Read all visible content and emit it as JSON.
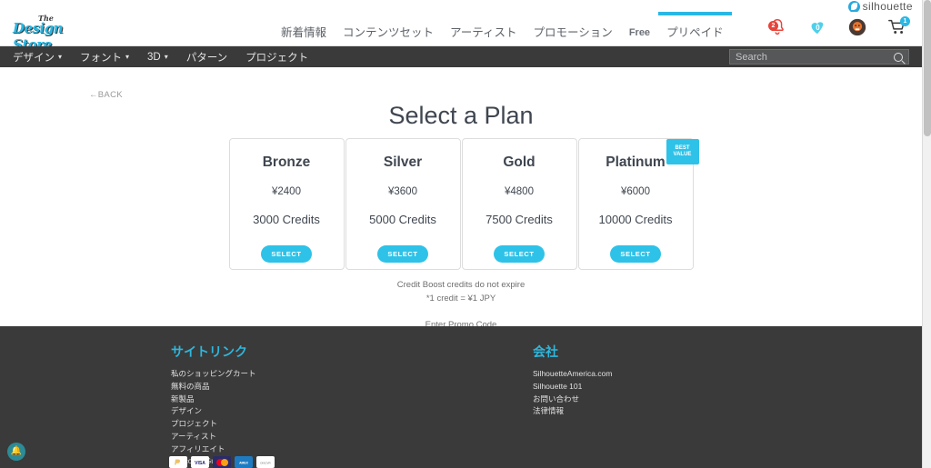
{
  "brand": {
    "silhouette_label": "silhouette",
    "logo_the": "The",
    "logo_main": "Design Store"
  },
  "topnav": {
    "links": [
      {
        "label": "新着情報",
        "active": false,
        "small": false
      },
      {
        "label": "コンテンツセット",
        "active": false,
        "small": false
      },
      {
        "label": "アーティスト",
        "active": false,
        "small": false
      },
      {
        "label": "プロモーション",
        "active": false,
        "small": false
      },
      {
        "label": "Free",
        "active": false,
        "small": true
      },
      {
        "label": "プリペイド",
        "active": true,
        "small": false
      }
    ],
    "icons": {
      "notifications_count": "2",
      "favorites_count": "0",
      "cart_count": "1"
    }
  },
  "darknav": {
    "items": [
      {
        "label": "デザイン",
        "caret": true
      },
      {
        "label": "フォント",
        "caret": true
      },
      {
        "label": "3D",
        "caret": true
      },
      {
        "label": "パターン",
        "caret": false
      },
      {
        "label": "プロジェクト",
        "caret": false
      }
    ],
    "search": {
      "placeholder": "Search",
      "value": ""
    }
  },
  "main": {
    "back_label": "←BACK",
    "title": "Select a Plan",
    "plans": [
      {
        "name": "Bronze",
        "price": "¥2400",
        "credits": "3000 Credits",
        "button": "SELECT",
        "badge": null
      },
      {
        "name": "Silver",
        "price": "¥3600",
        "credits": "5000 Credits",
        "button": "SELECT",
        "badge": null
      },
      {
        "name": "Gold",
        "price": "¥4800",
        "credits": "7500 Credits",
        "button": "SELECT",
        "badge": null
      },
      {
        "name": "Platinum",
        "price": "¥6000",
        "credits": "10000 Credits",
        "button": "SELECT",
        "badge_line1": "BEST",
        "badge_line2": "VALUE"
      }
    ],
    "fineprint_1": "Credit Boost credits do not expire",
    "fineprint_2": "*1 credit = ¥1 JPY",
    "promo_link": "Enter Promo Code"
  },
  "footer": {
    "col_left": {
      "heading": "サイトリンク",
      "items": [
        "私のショッピングカート",
        "無料の商品",
        "新製品",
        "デザイン",
        "プロジェクト",
        "アーティスト",
        "アフィリエイト",
        "Welcome Guide"
      ]
    },
    "col_right": {
      "heading": "会社",
      "items": [
        "SilhouetteAmerica.com",
        "Silhouette 101",
        "お問い合わせ",
        "法律情報"
      ]
    }
  },
  "colors": {
    "accent_cyan": "#2ec2e8",
    "dark_bar": "#3a3a3a",
    "footer_heading": "#2eb7dd",
    "chat_teal": "#2c8b96",
    "badge_red": "#e8443a"
  }
}
